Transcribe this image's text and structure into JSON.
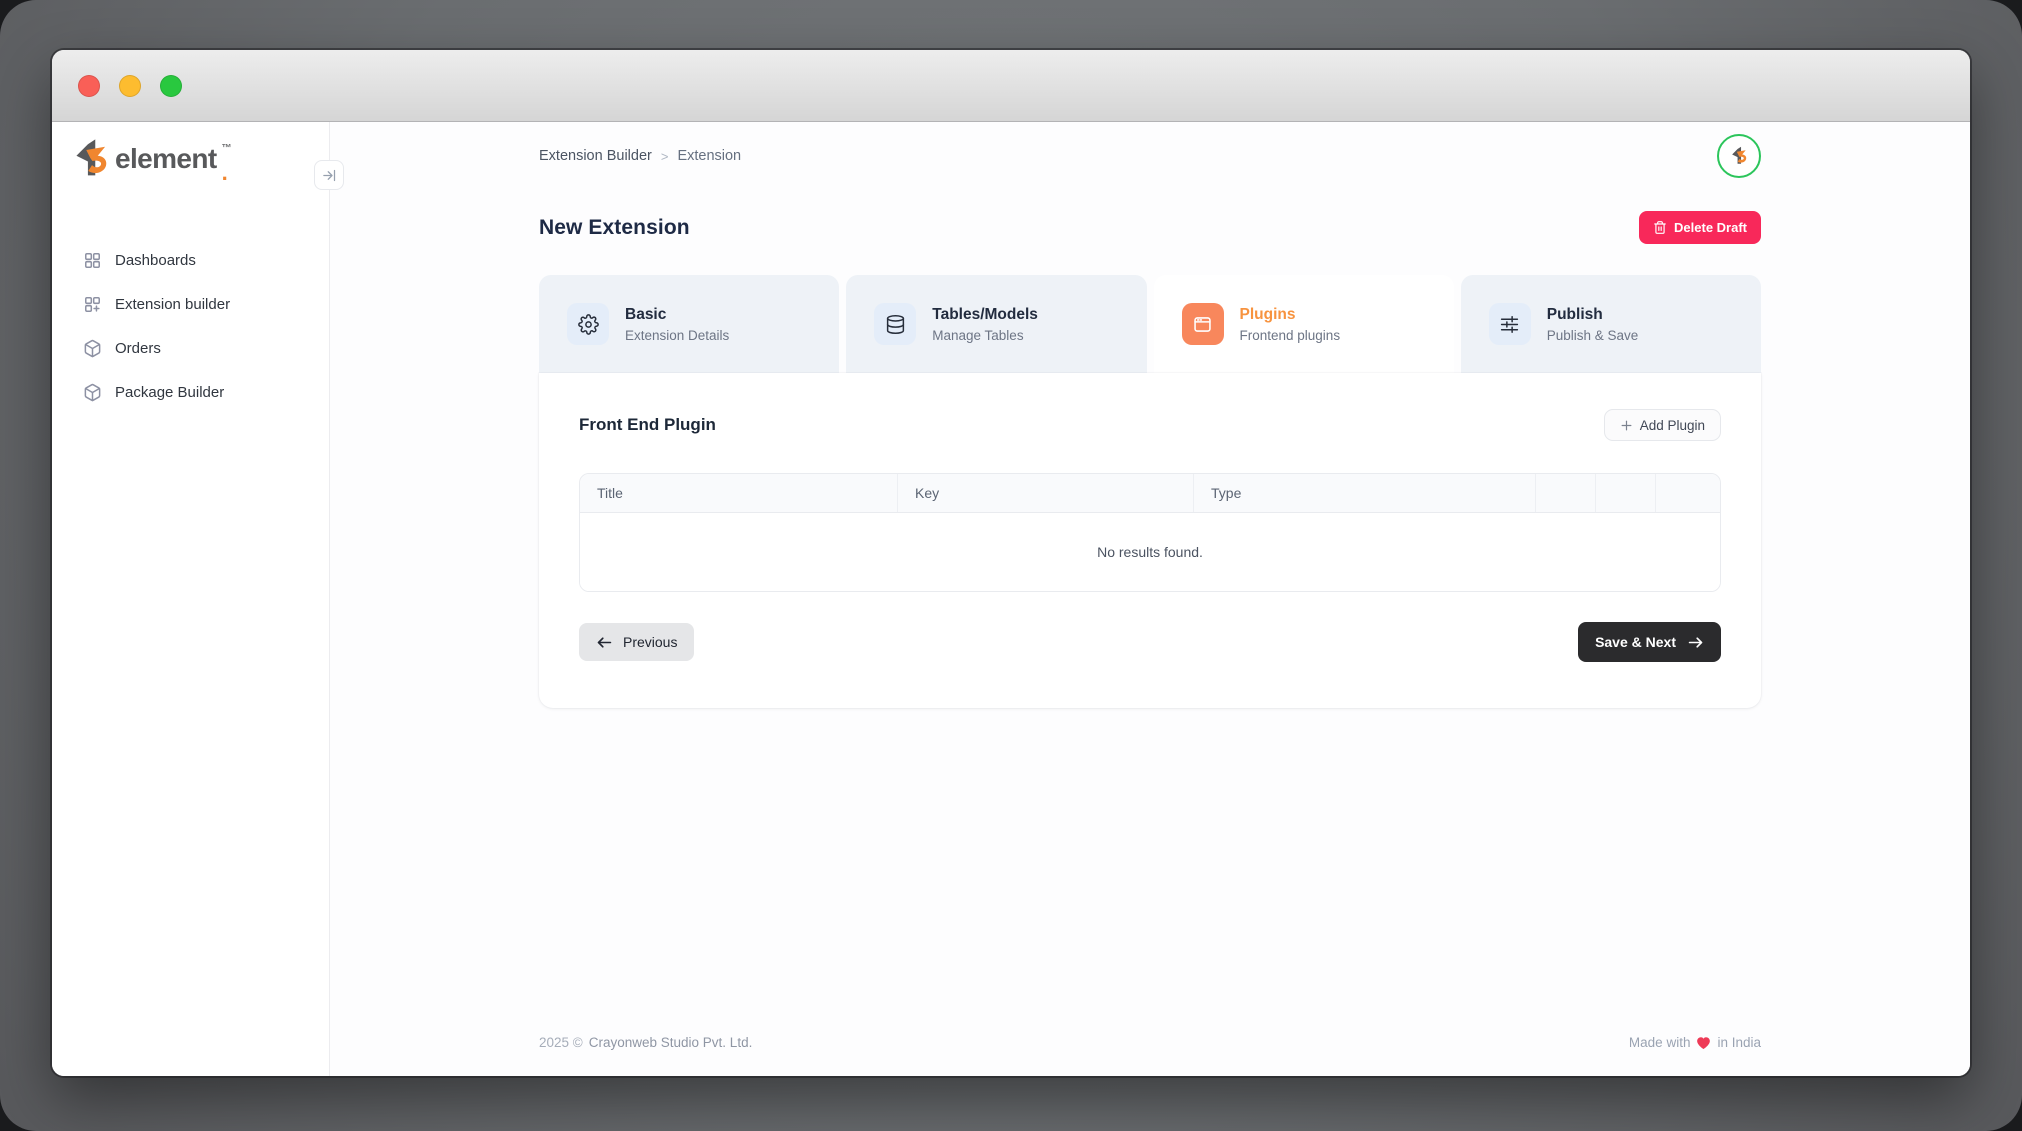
{
  "brand": {
    "wordmark": "element",
    "tm": "™",
    "dot": "."
  },
  "sidebar": {
    "items": [
      {
        "label": "Dashboards"
      },
      {
        "label": "Extension builder"
      },
      {
        "label": "Orders"
      },
      {
        "label": "Package Builder"
      }
    ]
  },
  "header": {
    "breadcrumb": {
      "items": [
        "Extension Builder",
        "Extension"
      ],
      "separator": ">"
    }
  },
  "page": {
    "title": "New Extension",
    "delete_draft_label": "Delete Draft"
  },
  "steps": [
    {
      "title": "Basic",
      "subtitle": "Extension Details",
      "icon": "gear-icon",
      "active": false
    },
    {
      "title": "Tables/Models",
      "subtitle": "Manage Tables",
      "icon": "database-icon",
      "active": false
    },
    {
      "title": "Plugins",
      "subtitle": "Frontend plugins",
      "icon": "browser-window-icon",
      "active": true
    },
    {
      "title": "Publish",
      "subtitle": "Publish & Save",
      "icon": "sliders-icon",
      "active": false
    }
  ],
  "panel": {
    "heading": "Front End Plugin",
    "add_plugin_label": "Add Plugin",
    "table": {
      "columns": [
        "Title",
        "Key",
        "Type"
      ],
      "empty_message": "No results found."
    },
    "previous_label": "Previous",
    "save_next_label": "Save & Next"
  },
  "footer": {
    "left": "2025 ©",
    "company": "Crayonweb Studio Pvt. Ltd.",
    "made_with": "Made with",
    "location": "in India"
  },
  "colors": {
    "accent_orange": "#f8875c",
    "accent_orange_text": "#f7933f",
    "danger_pink": "#f8285a",
    "avatar_ring_green": "#2bc55b",
    "primary_dark_button": "#2b2b2d",
    "inactive_tab_bg": "#eef2f7",
    "tab_icon_bg": "#e4edf9"
  }
}
